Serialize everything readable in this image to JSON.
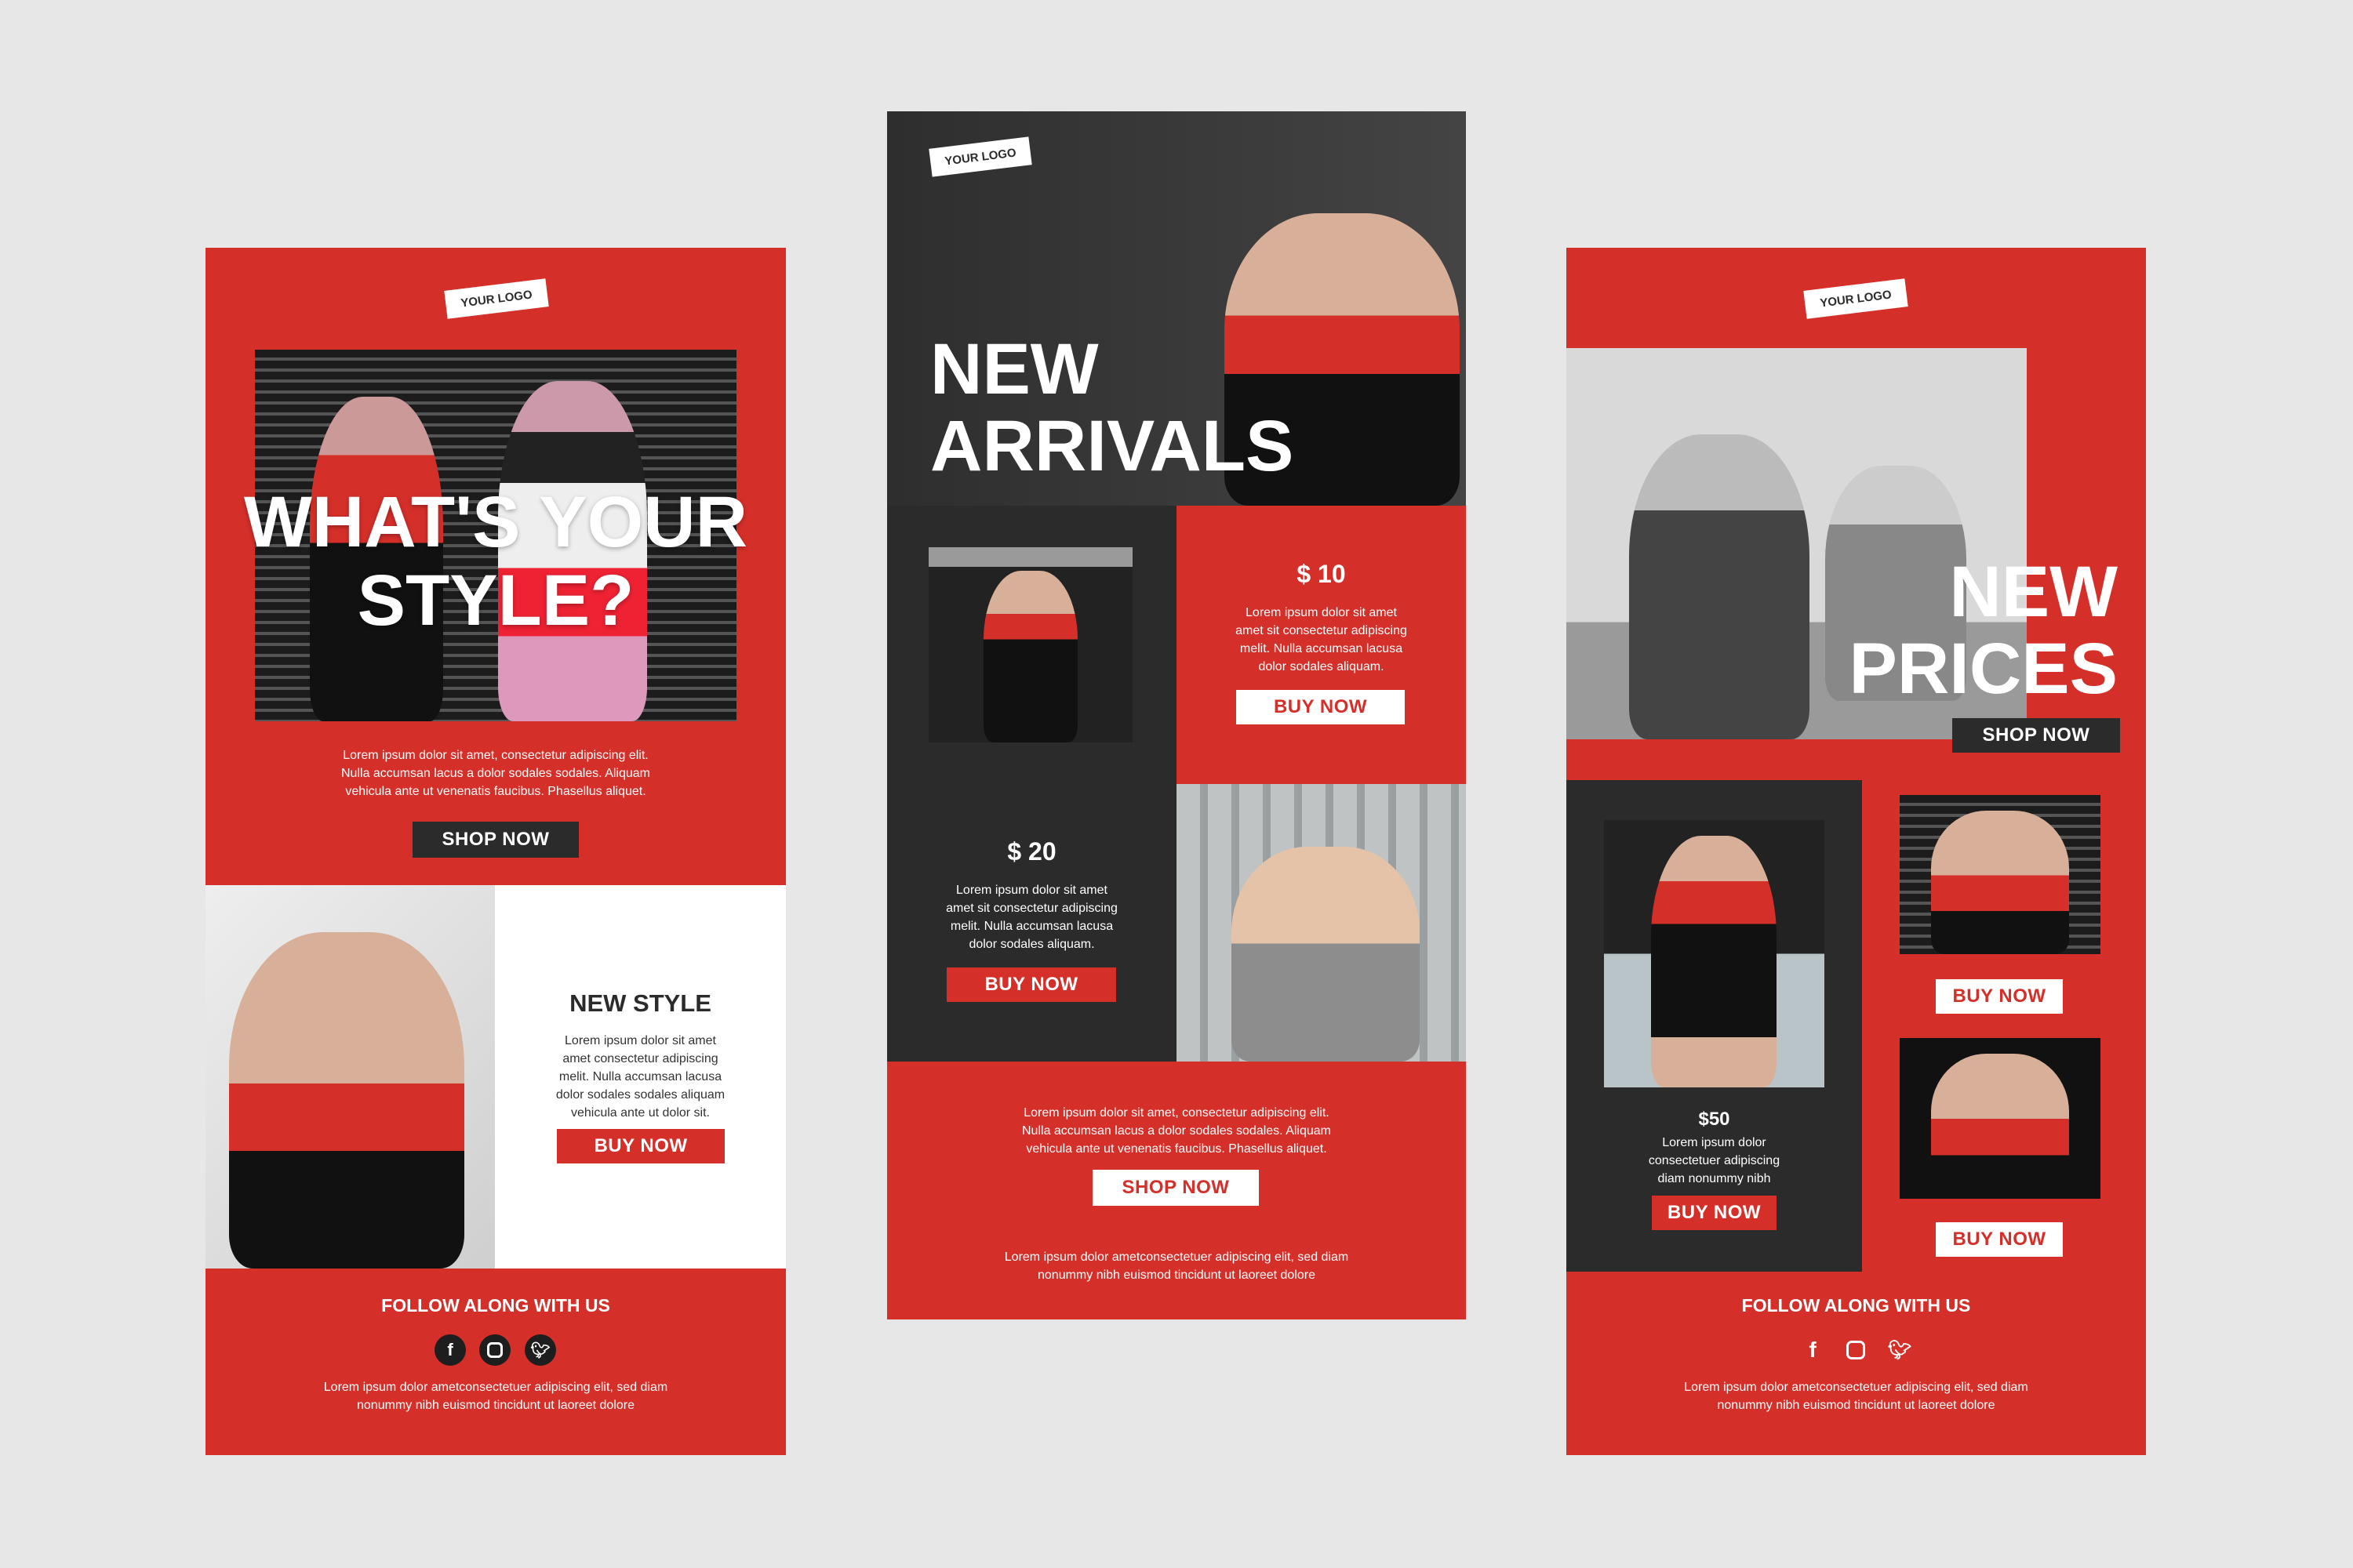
{
  "colors": {
    "red": "#d52f29",
    "dark": "#2b2b2b",
    "background": "#e7e7e7"
  },
  "left": {
    "logo": "YOUR LOGO",
    "headline": "WHAT'S YOUR\nSTYLE?",
    "intro": "Lorem ipsum dolor sit amet, consectetur adipiscing elit.\nNulla accumsan lacus a dolor sodales sodales. Aliquam\nvehicula ante ut venenatis faucibus. Phasellus aliquet.",
    "shop_label": "SHOP NOW",
    "feature_title": "NEW STYLE",
    "feature_text": "Lorem ipsum dolor sit amet\namet consectetur adipiscing\nmelit. Nulla accumsan lacusa\ndolor sodales sodales aliquam\nvehicula ante ut dolor sit.",
    "buy_label": "BUY NOW",
    "follow": "FOLLOW ALONG WITH US",
    "footer_text": "Lorem ipsum dolor ametconsectetuer adipiscing elit, sed diam\nnonummy nibh euismod tincidunt ut laoreet dolore",
    "social": [
      "facebook-icon",
      "instagram-icon",
      "twitter-icon"
    ]
  },
  "middle": {
    "logo": "YOUR LOGO",
    "headline": "NEW\nARRIVALS",
    "product1": {
      "price": "$ 10",
      "text": "Lorem ipsum dolor sit amet\namet sit consectetur adipiscing\nmelit. Nulla accumsan lacusa\ndolor sodales aliquam.",
      "buy": "BUY NOW"
    },
    "product2": {
      "price": "$ 20",
      "text": "Lorem ipsum dolor sit amet\namet sit consectetur adipiscing\nmelit. Nulla accumsan lacusa\ndolor sodales aliquam.",
      "buy": "BUY NOW"
    },
    "bottom_text": "Lorem ipsum dolor sit amet, consectetur adipiscing elit.\nNulla accumsan lacus a dolor sodales sodales. Aliquam\nvehicula ante ut venenatis faucibus. Phasellus aliquet.",
    "shop_label": "SHOP NOW",
    "footer_text": "Lorem ipsum dolor ametconsectetuer adipiscing elit, sed diam\nnonummy nibh euismod tincidunt ut laoreet dolore"
  },
  "right": {
    "logo": "YOUR LOGO",
    "headline": "NEW\nPRICES",
    "shop_label": "SHOP NOW",
    "product": {
      "price": "$50",
      "text": "Lorem ipsum dolor\nconsectetuer adipiscing\ndiam nonummy nibh",
      "buy": "BUY NOW"
    },
    "buy1": "BUY NOW",
    "buy2": "BUY NOW",
    "follow": "FOLLOW ALONG WITH US",
    "footer_text": "Lorem ipsum dolor ametconsectetuer adipiscing elit, sed diam\nnonummy nibh euismod tincidunt ut laoreet dolore",
    "social": [
      "facebook-icon",
      "instagram-icon",
      "twitter-icon"
    ]
  }
}
